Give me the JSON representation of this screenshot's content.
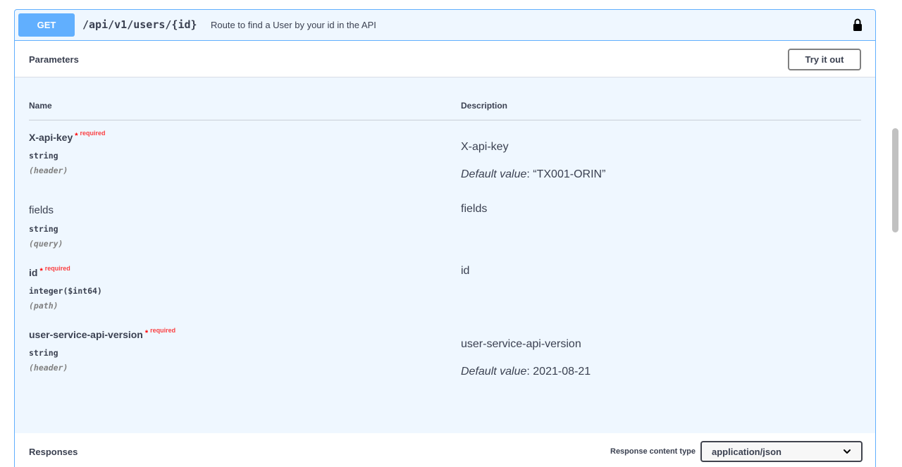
{
  "operation": {
    "method": "GET",
    "path": "/api/v1/users/{id}",
    "summary": "Route to find a User by your id in the API",
    "lock_icon": "lock-icon",
    "method_color": "#61affe"
  },
  "parameters": {
    "title": "Parameters",
    "try_label": "Try it out",
    "col_name": "Name",
    "col_description": "Description",
    "items": [
      {
        "name": "X-api-key",
        "required_star": "*",
        "required_text": "required",
        "type": "string",
        "in": "(header)",
        "description": "X-api-key",
        "default_label": "Default value",
        "default_value": ": “TX001-ORIN”"
      },
      {
        "name": "fields",
        "type": "string",
        "in": "(query)",
        "description": "fields"
      },
      {
        "name": "id",
        "required_star": "*",
        "required_text": "required",
        "type": "integer($int64)",
        "in": "(path)",
        "description": "id"
      },
      {
        "name": "user-service-api-version",
        "required_star": "*",
        "required_text": "required",
        "type": "string",
        "in": "(header)",
        "description": "user-service-api-version",
        "default_label": "Default value",
        "default_value": ": 2021-08-21"
      }
    ]
  },
  "responses": {
    "title": "Responses",
    "content_type_label": "Response content type",
    "content_type_value": "application/json",
    "chevron_icon": "chevron-down-icon"
  }
}
